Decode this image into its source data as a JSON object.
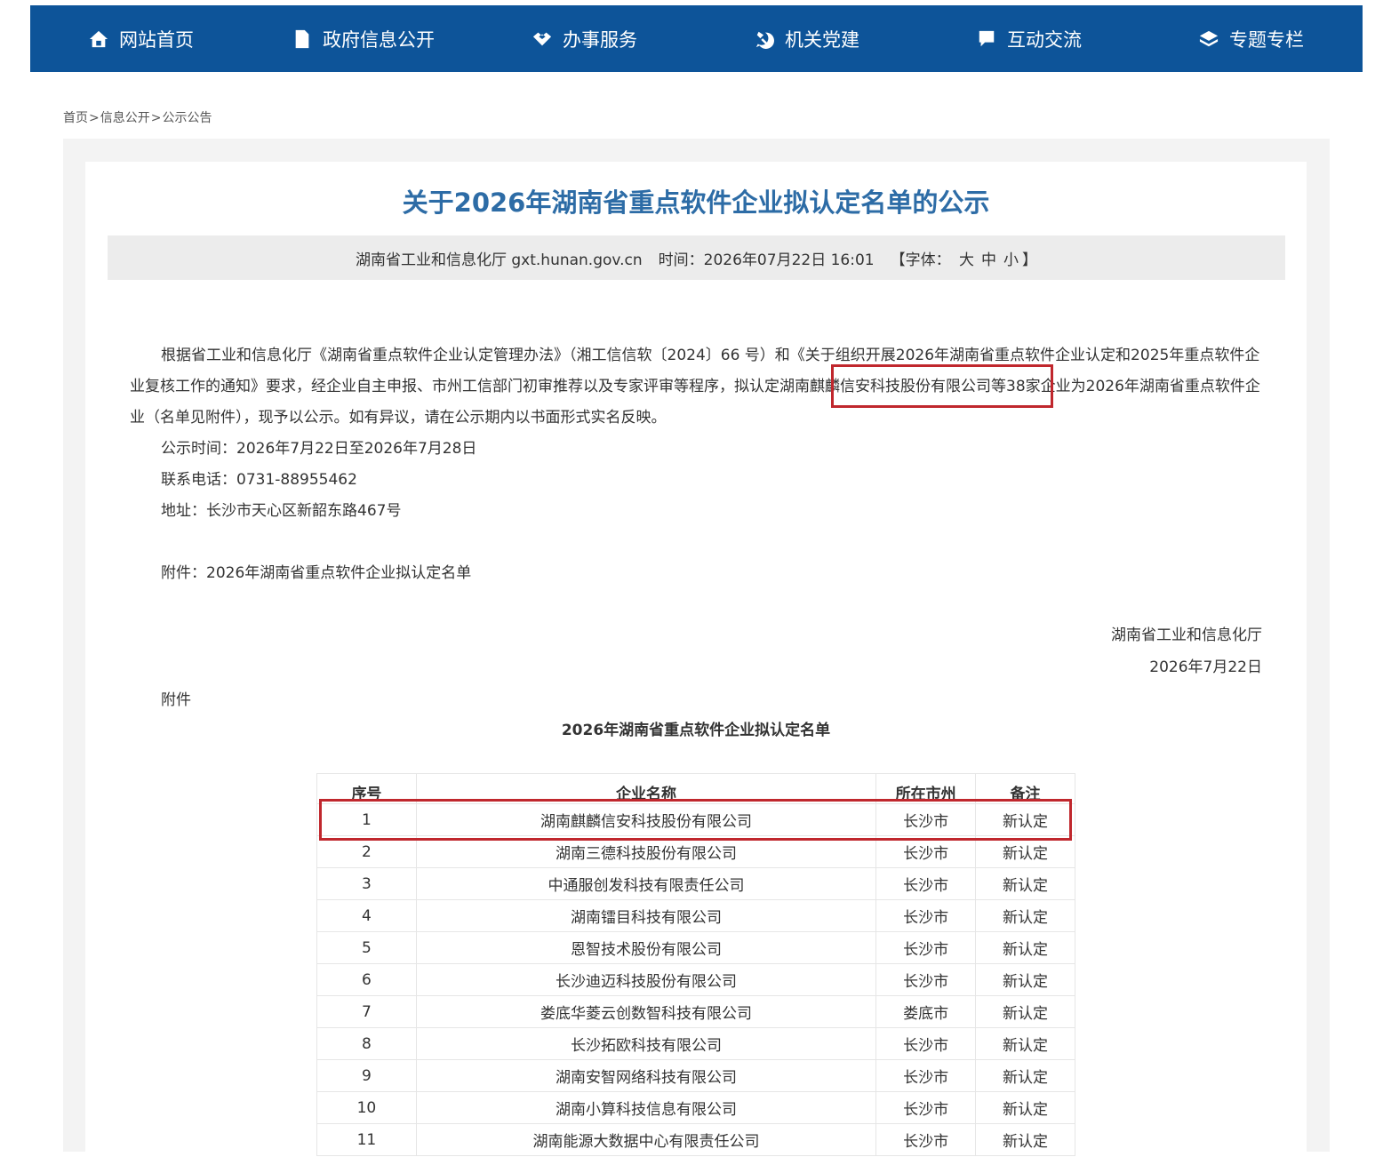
{
  "nav": {
    "items": [
      {
        "label": "网站首页",
        "icon": "home-icon"
      },
      {
        "label": "政府信息公开",
        "icon": "document-icon"
      },
      {
        "label": "办事服务",
        "icon": "handshake-icon"
      },
      {
        "label": "机关党建",
        "icon": "party-emblem-icon"
      },
      {
        "label": "互动交流",
        "icon": "chat-icon"
      },
      {
        "label": "专题专栏",
        "icon": "layers-icon"
      }
    ]
  },
  "breadcrumb": {
    "home": "首页",
    "sep": ">",
    "level2": "信息公开",
    "level3": "公示公告"
  },
  "article": {
    "title": "关于2026年湖南省重点软件企业拟认定名单的公示",
    "source": "湖南省工业和信息化厅 gxt.hunan.gov.cn",
    "time": "时间：2026年07月22日 16:01",
    "font_label": "【字体：",
    "font_large": "大",
    "font_medium": "中",
    "font_small": "小",
    "font_close": "】",
    "para1_a": "根据省工业和信息化厅《湖南省重点软件企业认定管理办法》（湘工信信软〔2024〕66 号）和《关于组织开展2026年湖南省重点软件企业认定和2025年重点软件企业复核工作的通知》要求，经企业自主申报、市州工信部门初审推荐以及专家评审等程序，拟认定",
    "para1_company": "湖南麒麟信安科技股份有限公司",
    "para1_b": "等38家企业为2026年湖南省重点软件企业（名单见附件），现予以公示。如有异议，请在公示期内以书面形式实名反映。",
    "period": "公示时间：2026年7月22日至2026年7月28日",
    "phone": "联系电话：0731-88955462",
    "address": "地址：长沙市天心区新韶东路467号",
    "attachment": "附件：2026年湖南省重点软件企业拟认定名单",
    "signoff_org": "湖南省工业和信息化厅",
    "signoff_date": "2026年7月22日",
    "attach_label": "附件",
    "table_title": "2026年湖南省重点软件企业拟认定名单"
  },
  "table": {
    "headers": [
      "序号",
      "企业名称",
      "所在市州",
      "备注"
    ],
    "rows": [
      [
        "1",
        "湖南麒麟信安科技股份有限公司",
        "长沙市",
        "新认定"
      ],
      [
        "2",
        "湖南三德科技股份有限公司",
        "长沙市",
        "新认定"
      ],
      [
        "3",
        "中通服创发科技有限责任公司",
        "长沙市",
        "新认定"
      ],
      [
        "4",
        "湖南镭目科技有限公司",
        "长沙市",
        "新认定"
      ],
      [
        "5",
        "恩智技术股份有限公司",
        "长沙市",
        "新认定"
      ],
      [
        "6",
        "长沙迪迈科技股份有限公司",
        "长沙市",
        "新认定"
      ],
      [
        "7",
        "娄底华菱云创数智科技有限公司",
        "娄底市",
        "新认定"
      ],
      [
        "8",
        "长沙拓欧科技有限公司",
        "长沙市",
        "新认定"
      ],
      [
        "9",
        "湖南安智网络科技有限公司",
        "长沙市",
        "新认定"
      ],
      [
        "10",
        "湖南小算科技信息有限公司",
        "长沙市",
        "新认定"
      ],
      [
        "11",
        "湖南能源大数据中心有限责任公司",
        "长沙市",
        "新认定"
      ]
    ]
  },
  "colors": {
    "nav_bg": "#0d5499",
    "title": "#2d6ca6",
    "highlight": "#c0272d"
  }
}
